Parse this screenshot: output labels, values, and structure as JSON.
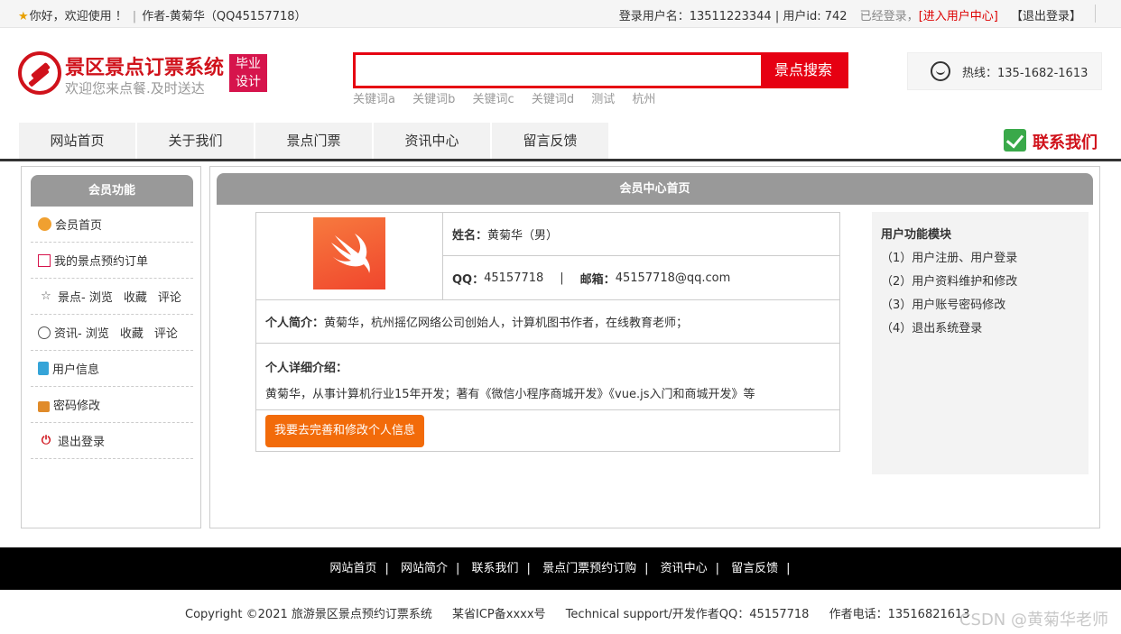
{
  "topbar": {
    "greeting": "你好，欢迎使用 ！",
    "author": "作者-黄菊华（QQ45157718）",
    "login_user": "登录用户名：13511223344 | 用户id: 742",
    "login_status": "已经登录，",
    "user_center": "[进入用户中心]",
    "logout": "【退出登录】"
  },
  "header": {
    "title": "景区景点订票系统",
    "subtitle": "欢迎您来点餐.及时送达",
    "badge_line1": "毕业",
    "badge_line2": "设计",
    "search_placeholder": "",
    "search_button": "景点搜索",
    "keywords": [
      "关键词a",
      "关键词b",
      "关键词c",
      "关键词d",
      "测试",
      "杭州"
    ],
    "hotline": "热线：135-1682-1613"
  },
  "nav": {
    "items": [
      "网站首页",
      "关于我们",
      "景点门票",
      "资讯中心",
      "留言反馈"
    ],
    "contact": "联系我们"
  },
  "sidebar": {
    "title": "会员功能",
    "items": [
      {
        "label": "会员首页",
        "icon": "home-icon"
      },
      {
        "label": "我的景点预约订单",
        "icon": "order-icon"
      },
      {
        "label": "景点- 浏览",
        "extra1": "收藏",
        "extra2": "评论",
        "icon": "star-icon"
      },
      {
        "label": "资讯- 浏览",
        "extra1": "收藏",
        "extra2": "评论",
        "icon": "clock-icon"
      },
      {
        "label": "用户信息",
        "icon": "user-info-icon"
      },
      {
        "label": "密码修改",
        "icon": "lock-icon"
      },
      {
        "label": "退出登录",
        "icon": "power-icon"
      }
    ]
  },
  "main": {
    "title": "会员中心首页",
    "profile": {
      "name_label": "姓名：",
      "name_value": "黄菊华（男）",
      "qq_label": "QQ：",
      "qq_value": "45157718",
      "sep": "|",
      "email_label": "邮箱：",
      "email_value": "45157718@qq.com",
      "intro_label": "个人简介：",
      "intro_value": "黄菊华，杭州摇亿网络公司创始人，计算机图书作者，在线教育老师；",
      "detail_label": "个人详细介绍：",
      "detail_value": "黄菊华，从事计算机行业15年开发；著有《微信小程序商城开发》《vue.js入门和商城开发》等",
      "edit_button": "我要去完善和修改个人信息"
    },
    "features": {
      "title": "用户功能模块",
      "items": [
        "（1）用户注册、用户登录",
        "（2）用户资料维护和修改",
        "（3）用户账号密码修改",
        "（4）退出系统登录"
      ]
    }
  },
  "footer": {
    "nav": [
      "网站首页",
      "网站简介",
      "联系我们",
      "景点门票预约订购",
      "资讯中心",
      "留言反馈"
    ],
    "separator": "|",
    "copyright": "Copyright ©2021 旅游景区景点预约订票系统",
    "icp": "某省ICP备xxxx号",
    "support": "Technical support/开发作者QQ：45157718",
    "phone": "作者电话：13516821613",
    "watermark": "CSDN @黄菊华老师"
  },
  "colors": {
    "brand_red": "#d0121b",
    "search_red": "#e60012",
    "button_orange": "#f26b0a",
    "header_gray": "#999999"
  }
}
